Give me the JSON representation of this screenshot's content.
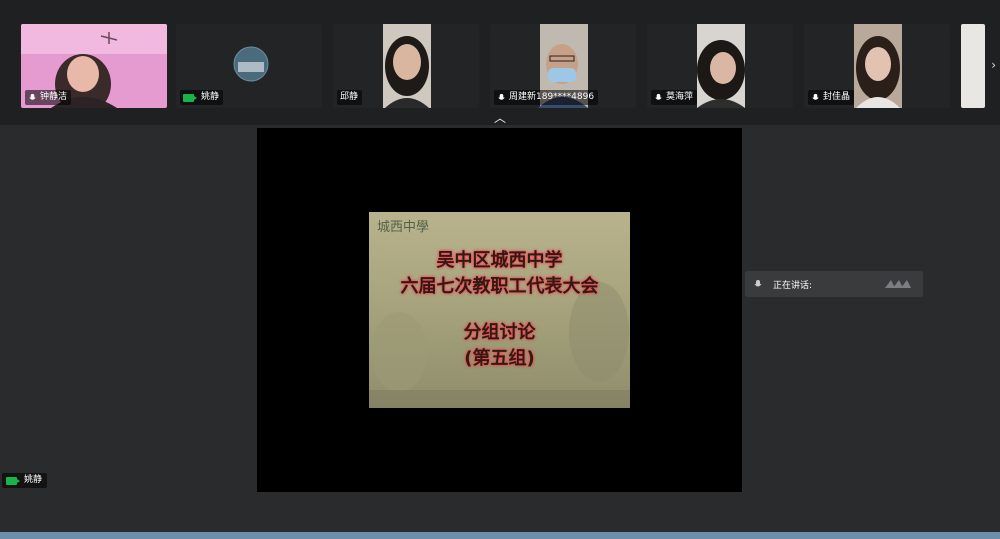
{
  "participants": [
    {
      "name": "钟静洁",
      "icon": "mic-icon"
    },
    {
      "name": "姚静",
      "icon": "camera-icon"
    },
    {
      "name": "邱静",
      "icon": "none"
    },
    {
      "name": "周建新189****4896",
      "icon": "mic-icon"
    },
    {
      "name": "莫海萍",
      "icon": "mic-icon"
    },
    {
      "name": "封佳晶",
      "icon": "mic-icon"
    }
  ],
  "controls": {
    "collapse": "︿",
    "more": "•••",
    "next": "›"
  },
  "slide": {
    "school_logo": "城西中學",
    "line1": "吴中区城西中学",
    "line2": "六届七次教职工代表大会",
    "line3": "分组讨论",
    "line4": "(第五组)"
  },
  "speaking": {
    "label": "正在讲话:"
  },
  "self_view": {
    "name": "姚静"
  },
  "colors": {
    "background": "#2a2b2d",
    "strip": "#1f2022",
    "camera_on": "#19b34b",
    "slide_glow": "#ff3c50"
  }
}
